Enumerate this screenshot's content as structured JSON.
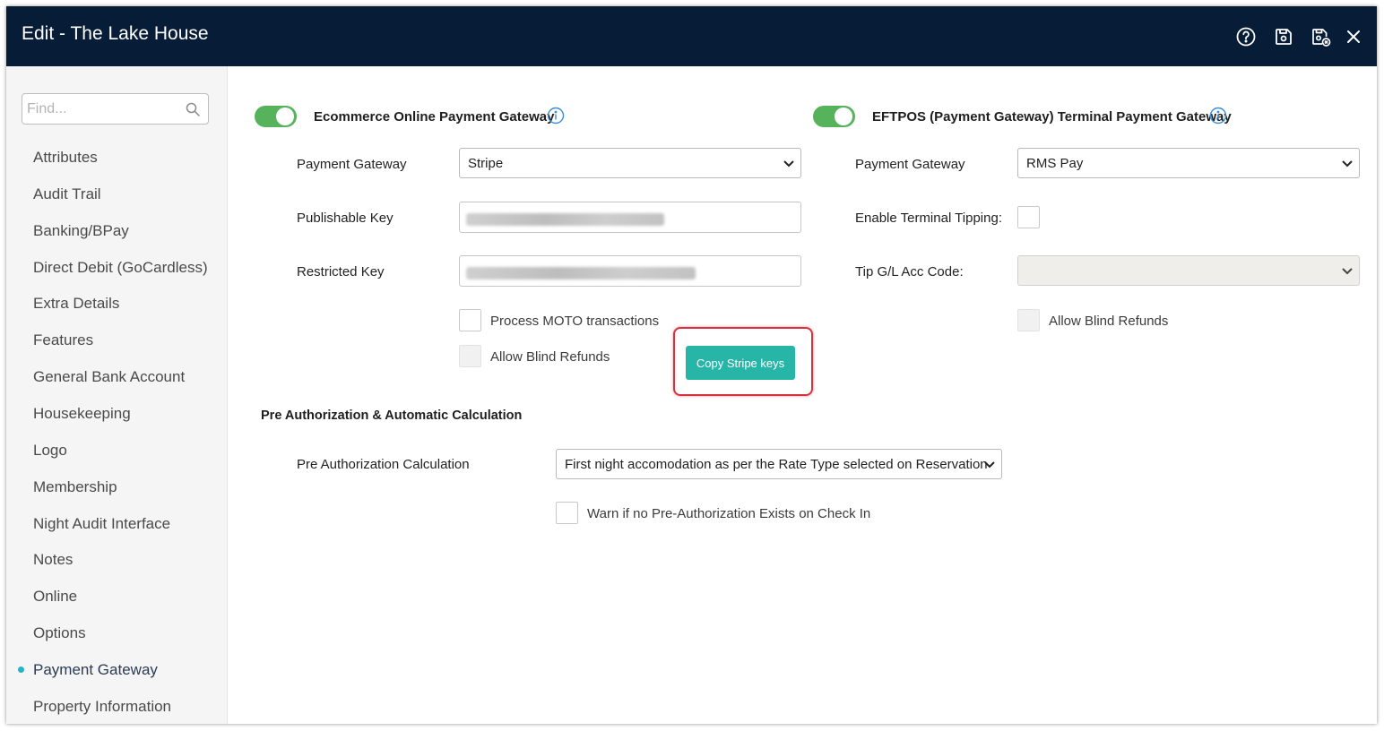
{
  "window": {
    "title": "Edit - The Lake House",
    "icons": [
      "help-circle-icon",
      "save-icon",
      "save-close-icon",
      "close-icon"
    ]
  },
  "sidebar": {
    "search_placeholder": "Find...",
    "items": [
      {
        "label": "Attributes"
      },
      {
        "label": "Audit Trail"
      },
      {
        "label": "Banking/BPay"
      },
      {
        "label": "Direct Debit (GoCardless)"
      },
      {
        "label": "Extra Details"
      },
      {
        "label": "Features"
      },
      {
        "label": "General Bank Account"
      },
      {
        "label": "Housekeeping"
      },
      {
        "label": "Logo"
      },
      {
        "label": "Membership"
      },
      {
        "label": "Night Audit Interface"
      },
      {
        "label": "Notes"
      },
      {
        "label": "Online"
      },
      {
        "label": "Options"
      },
      {
        "label": "Payment Gateway",
        "active": true
      },
      {
        "label": "Property Information"
      }
    ],
    "active_color": "#27b3c4"
  },
  "ecommerce": {
    "toggle_on": true,
    "title": "Ecommerce Online Payment Gateway",
    "gateway_label": "Payment Gateway",
    "gateway_value": "Stripe",
    "publishable_key_label": "Publishable Key",
    "restricted_key_label": "Restricted Key",
    "moto_label": "Process MOTO transactions",
    "moto_checked": false,
    "blind_refunds_label": "Allow Blind Refunds",
    "blind_refunds_checked": false,
    "copy_button": "Copy Stripe keys"
  },
  "eftpos": {
    "toggle_on": true,
    "title": "EFTPOS (Payment Gateway) Terminal Payment Gateway",
    "gateway_label": "Payment Gateway",
    "gateway_value": "RMS Pay",
    "tipping_label": "Enable Terminal Tipping:",
    "tipping_checked": false,
    "tip_code_label": "Tip G/L Acc Code:",
    "tip_code_value": "",
    "blind_refunds_label": "Allow Blind Refunds",
    "blind_refunds_checked": false
  },
  "preauth": {
    "title": "Pre Authorization & Automatic Calculation",
    "calc_label": "Pre Authorization Calculation",
    "calc_value": "First night accomodation as per the Rate Type selected on Reservation",
    "warn_label": "Warn if no Pre-Authorization Exists on Check In",
    "warn_checked": false
  },
  "colors": {
    "titlebar": "#071c36",
    "toggle": "#56b35c",
    "button": "#27b5a8",
    "highlight": "#d5323f",
    "info": "#3a8fd6"
  }
}
